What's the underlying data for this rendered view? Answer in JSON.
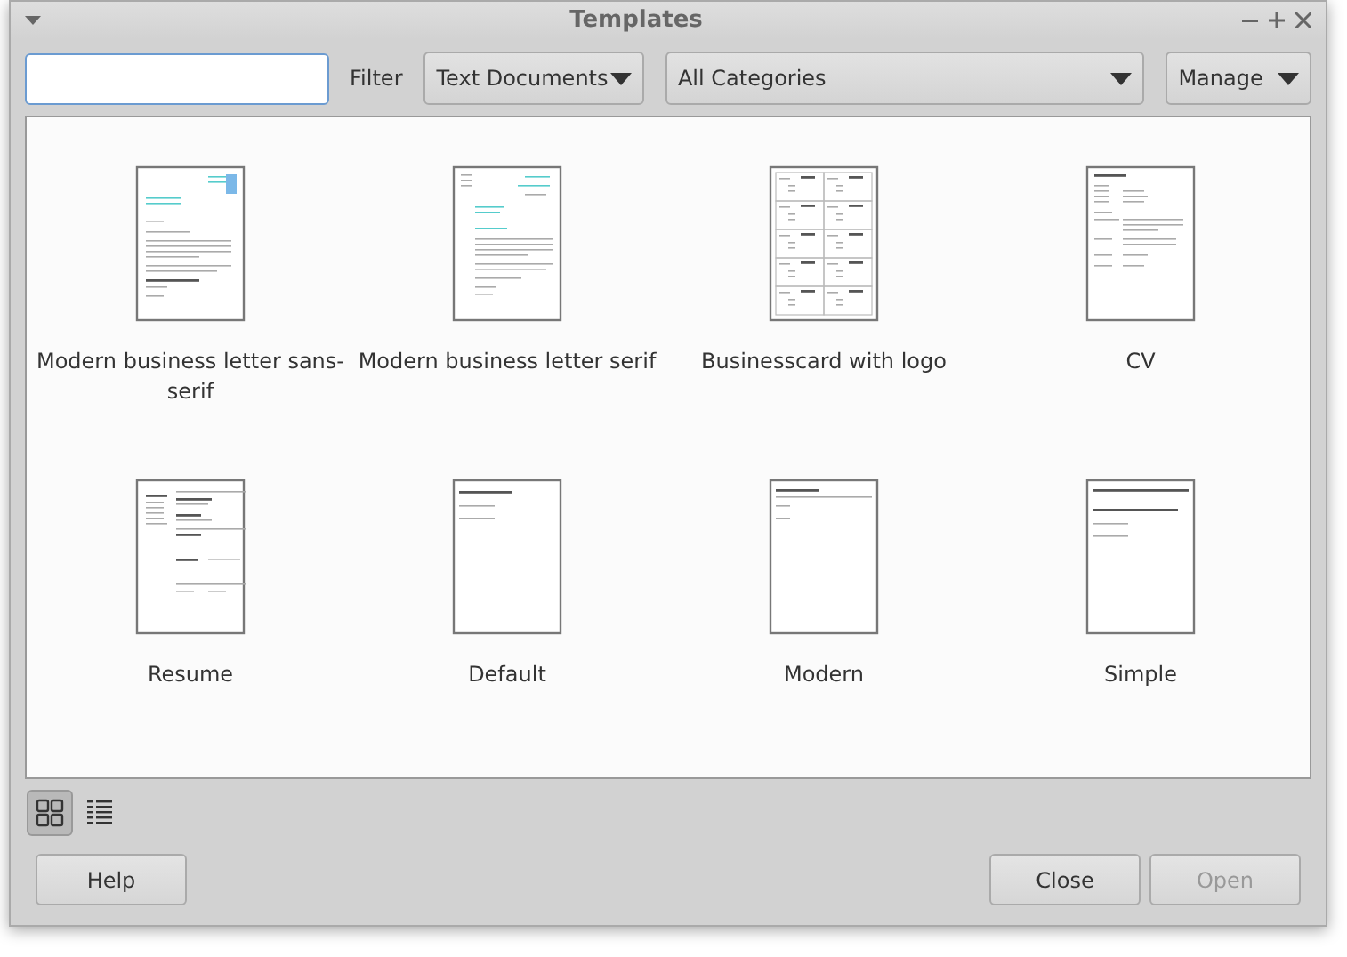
{
  "window": {
    "title": "Templates"
  },
  "filter": {
    "label": "Filter",
    "application": "Text Documents",
    "category": "All Categories",
    "manage": "Manage"
  },
  "templates": [
    {
      "name": "Modern business letter sans-serif",
      "kind": "logoletter"
    },
    {
      "name": "Modern business letter serif",
      "kind": "letter"
    },
    {
      "name": "Businesscard with logo",
      "kind": "cards"
    },
    {
      "name": "CV",
      "kind": "cv"
    },
    {
      "name": "Resume",
      "kind": "resume"
    },
    {
      "name": "Default",
      "kind": "default"
    },
    {
      "name": "Modern",
      "kind": "modern"
    },
    {
      "name": "Simple",
      "kind": "simple"
    }
  ],
  "view_modes": [
    {
      "kind": "thumbnails",
      "selected": true
    },
    {
      "kind": "list",
      "selected": false
    }
  ],
  "buttons": [
    {
      "label": "Help",
      "disabled": false
    },
    {
      "label": "Close",
      "disabled": false
    },
    {
      "label": "Open",
      "disabled": true
    }
  ]
}
